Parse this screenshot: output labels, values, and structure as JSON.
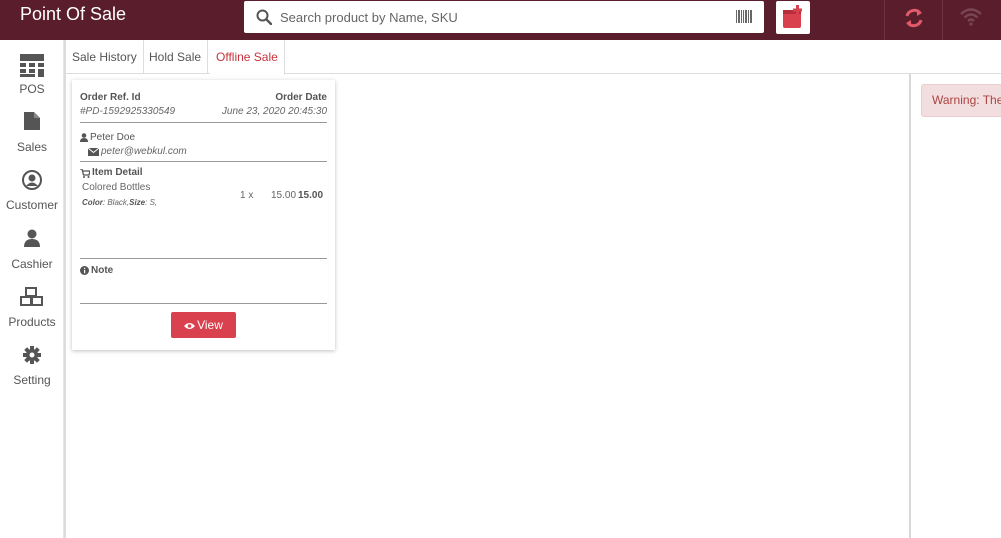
{
  "header": {
    "title": "Point Of Sale",
    "search_placeholder": "Search product by Name, SKU"
  },
  "sidebar": {
    "items": [
      {
        "label": "POS",
        "icon": "calculator-icon"
      },
      {
        "label": "Sales",
        "icon": "file-icon"
      },
      {
        "label": "Customer",
        "icon": "user-circle-icon"
      },
      {
        "label": "Cashier",
        "icon": "user-icon"
      },
      {
        "label": "Products",
        "icon": "cubes-icon"
      },
      {
        "label": "Setting",
        "icon": "gear-icon"
      }
    ]
  },
  "tabs": [
    {
      "label": "Sale History"
    },
    {
      "label": "Hold Sale"
    },
    {
      "label": "Offline Sale",
      "active": true
    }
  ],
  "order": {
    "ref_label": "Order Ref. Id",
    "ref_value": "#PD-1592925330549",
    "date_label": "Order Date",
    "date_value": "June 23, 2020 20:45:30",
    "customer_name": "Peter Doe",
    "customer_email": "peter@webkul.com",
    "item_detail_label": "Item Detail",
    "item_name": "Colored Bottles",
    "attr_color_label": "Color",
    "attr_color_value": ": Black,",
    "attr_size_label": "Size",
    "attr_size_value": ": S,",
    "qty": "1 x",
    "unit_price": "15.00",
    "line_total": "15.00",
    "note_label": "Note",
    "view_label": "View"
  },
  "warning": {
    "text": "Warning: There"
  },
  "colors": {
    "topbar": "#5a1d2c",
    "accent": "#d9414e",
    "active_tab": "#c7323c"
  }
}
